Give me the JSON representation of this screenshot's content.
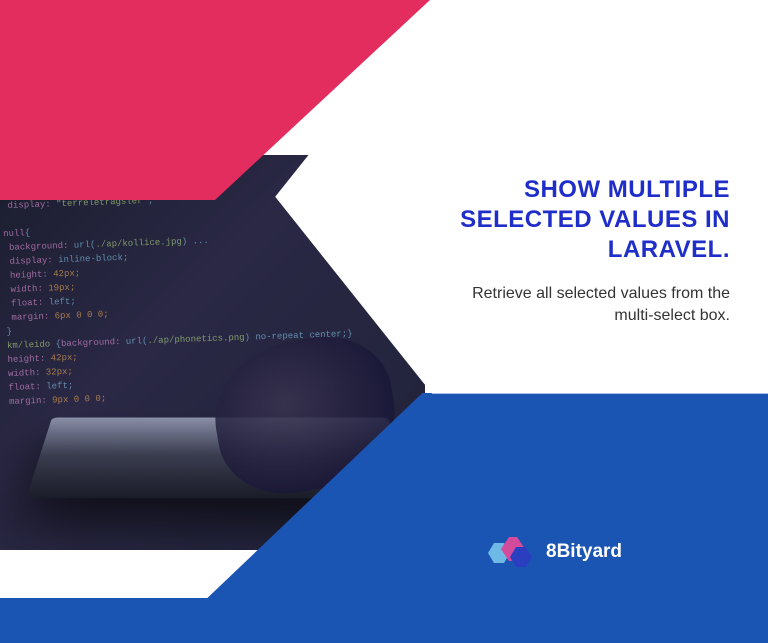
{
  "heading": "SHOW MULTIPLE SELECTED VALUES IN LARAVEL.",
  "subheading": "Retrieve all selected values from the multi-select box.",
  "brand": {
    "name": "8Bityard"
  },
  "colors": {
    "pink": "#e32d5e",
    "blue": "#1b55b4",
    "heading": "#202ec9"
  }
}
